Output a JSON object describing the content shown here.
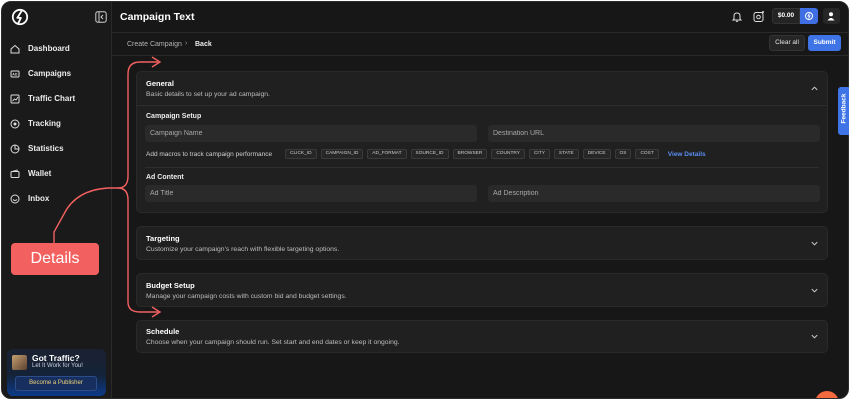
{
  "app": {
    "title": "Campaign Text"
  },
  "sidebar": {
    "items": [
      {
        "label": "Dashboard",
        "icon": "home-icon"
      },
      {
        "label": "Campaigns",
        "icon": "ad-icon"
      },
      {
        "label": "Traffic Chart",
        "icon": "chart-icon"
      },
      {
        "label": "Tracking",
        "icon": "target-icon"
      },
      {
        "label": "Statistics",
        "icon": "stats-icon"
      },
      {
        "label": "Wallet",
        "icon": "wallet-icon"
      },
      {
        "label": "Inbox",
        "icon": "inbox-icon"
      }
    ],
    "promo": {
      "title": "Got Traffic?",
      "subtitle": "Let It Work for You!",
      "button": "Become a Publisher"
    }
  },
  "topbar": {
    "balance": "$0.00"
  },
  "breadcrumb": {
    "parent": "Create Campaign",
    "separator": "›",
    "current": "Back"
  },
  "actions": {
    "clear": "Clear all",
    "submit": "Submit"
  },
  "general": {
    "title": "General",
    "description": "Basic details to set up your ad campaign.",
    "setup_label": "Campaign Setup",
    "campaign_name_placeholder": "Campaign Name",
    "destination_url_placeholder": "Destination URL",
    "macros_label": "Add macros to track campaign performance",
    "macros": [
      "CLICK_ID",
      "CAMPAIGN_ID",
      "AD_FORMAT",
      "SOURCE_ID",
      "BROWSER",
      "COUNTRY",
      "CITY",
      "STATE",
      "DEVICE",
      "OS",
      "COST"
    ],
    "view_details": "View Details",
    "content_label": "Ad Content",
    "ad_title_placeholder": "Ad Title",
    "ad_description_placeholder": "Ad Description"
  },
  "targeting": {
    "title": "Targeting",
    "description": "Customize your campaign's reach with flexible targeting options."
  },
  "budget": {
    "title": "Budget Setup",
    "description": "Manage your campaign costs with custom bid and budget settings."
  },
  "schedule": {
    "title": "Schedule",
    "description": "Choose when your campaign should run. Set start and end dates or keep it ongoing."
  },
  "feedback": {
    "label": "Feedback"
  },
  "annotation": {
    "label": "Details",
    "color": "#f26060"
  },
  "colors": {
    "accent": "#3f74e6",
    "background": "#171717",
    "panel": "#202020"
  }
}
